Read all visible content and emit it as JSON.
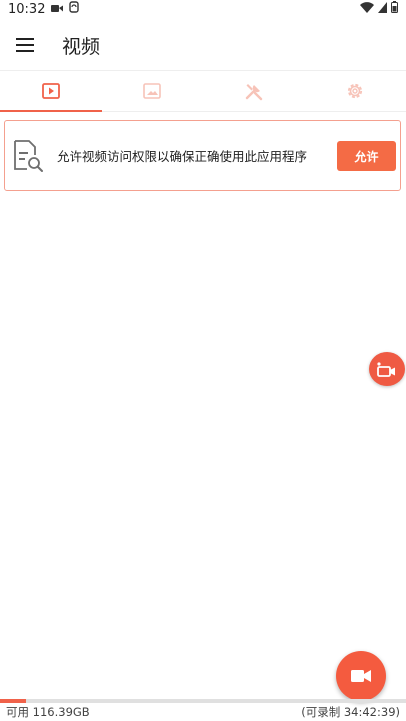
{
  "status_bar": {
    "time": "10:32"
  },
  "app_bar": {
    "title": "视频"
  },
  "tabs": [
    {
      "id": "videos",
      "icon": "video-play-icon",
      "active": true
    },
    {
      "id": "images",
      "icon": "image-icon",
      "active": false
    },
    {
      "id": "tools",
      "icon": "tools-icon",
      "active": false
    },
    {
      "id": "settings",
      "icon": "gear-icon",
      "active": false
    }
  ],
  "permission": {
    "message": "允许视频访问权限以确保正确使用此应用程序",
    "button_label": "允许"
  },
  "storage": {
    "available": "可用 116.39GB",
    "recordable": "(可录制 34:42:39)",
    "used_fraction": 0.065
  },
  "colors": {
    "accent": "#f0624a",
    "button": "#f46b45",
    "inactive_icon": "#f7c3b8"
  }
}
